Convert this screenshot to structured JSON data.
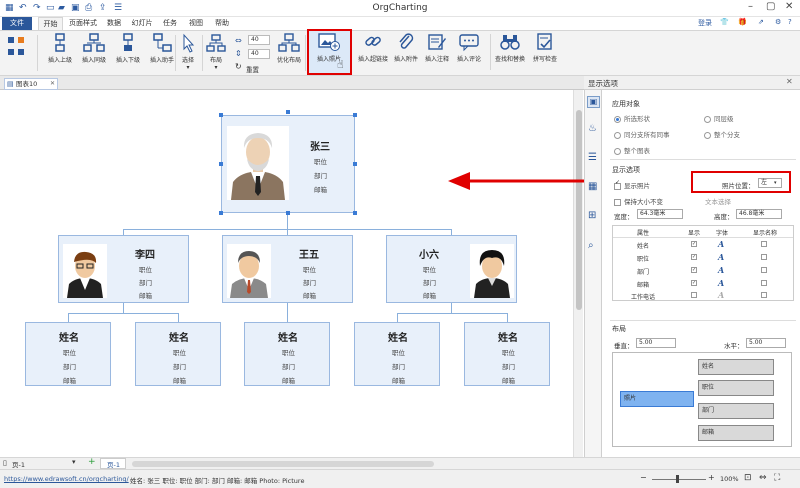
{
  "app": {
    "title": "OrgCharting"
  },
  "menu": {
    "file": "文件",
    "tabs": [
      "开始",
      "页面样式",
      "数据",
      "幻灯片",
      "任务",
      "视图",
      "帮助"
    ],
    "login": "登录"
  },
  "ribbon": {
    "insert_superior": "插入上级",
    "insert_peer": "插入同级",
    "insert_subordinate": "插入下级",
    "insert_assistant": "插入助手",
    "select": "选择",
    "layout": "布局",
    "spin1": "40",
    "spin2": "40",
    "reset": "重置",
    "optimize_layout": "优化布局",
    "insert_photo": "插入照片",
    "insert_hyperlink": "插入超链接",
    "insert_attachment": "插入附件",
    "insert_note": "插入注释",
    "insert_comment": "插入评论",
    "find_replace": "查找和替换",
    "spell_check": "拼写检查"
  },
  "document": {
    "tab": "图表10"
  },
  "chart": {
    "root": {
      "name": "张三",
      "lines": [
        "职位",
        "部门",
        "邮箱"
      ]
    },
    "level2": [
      {
        "name": "李四",
        "lines": [
          "职位",
          "部门",
          "邮箱"
        ]
      },
      {
        "name": "王五",
        "lines": [
          "职位",
          "部门",
          "邮箱"
        ]
      },
      {
        "name": "小六",
        "lines": [
          "职位",
          "部门",
          "邮箱"
        ]
      }
    ],
    "level3": [
      {
        "name": "姓名",
        "lines": [
          "职位",
          "部门",
          "邮箱"
        ]
      },
      {
        "name": "姓名",
        "lines": [
          "职位",
          "部门",
          "邮箱"
        ]
      },
      {
        "name": "姓名",
        "lines": [
          "职位",
          "部门",
          "邮箱"
        ]
      },
      {
        "name": "姓名",
        "lines": [
          "职位",
          "部门",
          "邮箱"
        ]
      },
      {
        "name": "姓名",
        "lines": [
          "职位",
          "部门",
          "邮箱"
        ]
      }
    ]
  },
  "panel": {
    "title": "显示选项",
    "apply_to": "应用对象",
    "apply_options": [
      "所选形状",
      "同层级",
      "同分支所有同事",
      "整个分支",
      "整个图表"
    ],
    "display_options": "显示选项",
    "show_photo": "显示照片",
    "photo_position_label": "照片位置：",
    "photo_position_value": "左",
    "keep_size": "保持大小不变",
    "text_select": "文本选择",
    "width_label": "宽度：",
    "width_value": "64.3毫米",
    "height_label": "高度：",
    "height_value": "46.8毫米",
    "table_headers": [
      "属性",
      "显示",
      "字体",
      "显示名称"
    ],
    "table_rows": [
      "姓名",
      "职位",
      "部门",
      "邮箱",
      "工作电话"
    ],
    "font_glyph": "A",
    "layout_title": "布局",
    "vertical_label": "垂直：",
    "vertical_value": "5.00",
    "horizontal_label": "水平：",
    "horizontal_value": "5.00",
    "layout_photo": "照片",
    "layout_fields": [
      "姓名",
      "职位",
      "部门",
      "邮箱"
    ]
  },
  "status": {
    "page_selector": "页-1",
    "page_tab": "页-1",
    "url": "https://www.edrawsoft.cn/orgcharting/",
    "info": "姓名: 张三  职位: 职位  部门: 部门  邮箱: 邮箱  Photo: Picture",
    "zoom": "100%"
  },
  "colors": {
    "accent": "#2b579a",
    "highlight": "#e00000",
    "card": "#e8f0fa"
  }
}
